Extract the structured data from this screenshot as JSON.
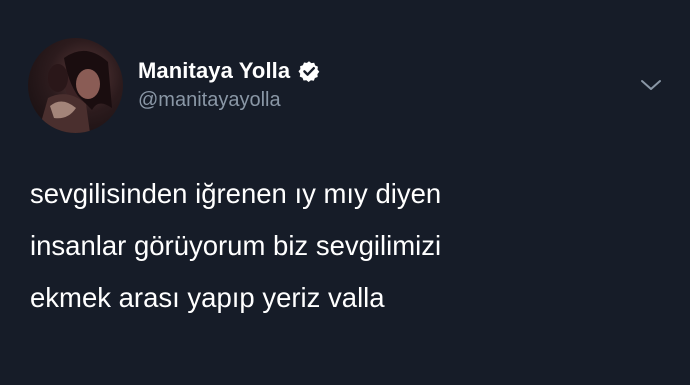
{
  "tweet": {
    "author": {
      "display_name": "Manitaya Yolla",
      "handle": "@manitayayolla",
      "verified": true
    },
    "text_lines": [
      "sevgilisinden iğrenen ıy mıy diyen",
      "insanlar görüyorum biz sevgilimizi",
      "ekmek arası yapıp yeriz valla"
    ]
  },
  "icons": {
    "verified": "verified-badge-icon",
    "menu": "chevron-down-icon"
  },
  "colors": {
    "background": "#161c28",
    "text": "#ffffff",
    "handle": "#8a97a6"
  }
}
